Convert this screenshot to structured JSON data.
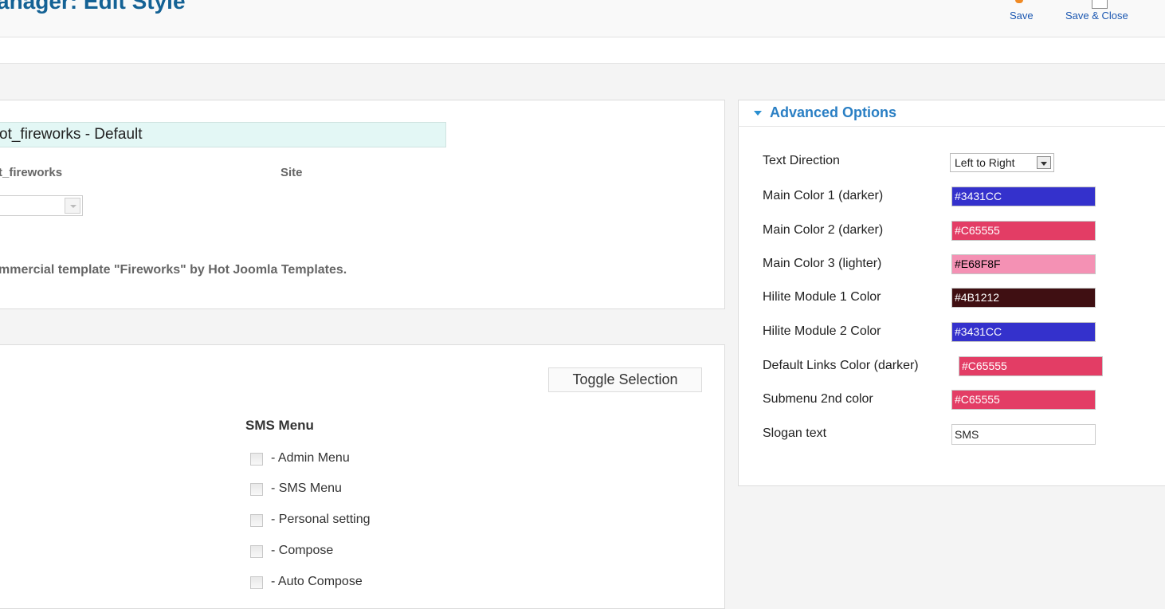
{
  "header": {
    "title": "anager: Edit Style",
    "save_label": "Save",
    "save_close_label": "Save & Close"
  },
  "details": {
    "style_name": "ot_fireworks - Default",
    "template_name": "t_fireworks",
    "client": "Site",
    "description": "mmercial template \"Fireworks\" by Hot Joomla Templates."
  },
  "assignment": {
    "toggle_label": "Toggle Selection",
    "menu_heading": "SMS Menu",
    "items": [
      {
        "label": "- Admin Menu",
        "checked": false
      },
      {
        "label": "- SMS Menu",
        "checked": false
      },
      {
        "label": "- Personal setting",
        "checked": false
      },
      {
        "label": "- Compose",
        "checked": false
      },
      {
        "label": "- Auto Compose",
        "checked": false
      }
    ]
  },
  "advanced": {
    "title": "Advanced Options",
    "text_direction_label": "Text Direction",
    "text_direction_value": "Left to Right",
    "colors": [
      {
        "label": "Main Color 1 (darker)",
        "value": "#3431CC",
        "bg": "#3431CC",
        "text_color": "#ffffff"
      },
      {
        "label": "Main Color 2 (darker)",
        "value": "#C65555",
        "bg": "#E33D65",
        "text_color": "#ffffff"
      },
      {
        "label": "Main Color 3 (lighter)",
        "value": "#E68F8F",
        "bg": "#F491B4",
        "text_color": "#000000"
      },
      {
        "label": "Hilite Module 1 Color",
        "value": "#4B1212",
        "bg": "#3F0F12",
        "text_color": "#ffffff"
      },
      {
        "label": "Hilite Module 2 Color",
        "value": "#3431CC",
        "bg": "#3431CC",
        "text_color": "#ffffff"
      },
      {
        "label": "Default Links Color (darker)",
        "value": "#C65555",
        "bg": "#E33D65",
        "text_color": "#ffffff"
      },
      {
        "label": "Submenu 2nd color",
        "value": "#C65555",
        "bg": "#E33D65",
        "text_color": "#ffffff"
      }
    ],
    "slogan_label": "Slogan text",
    "slogan_value": "SMS"
  }
}
